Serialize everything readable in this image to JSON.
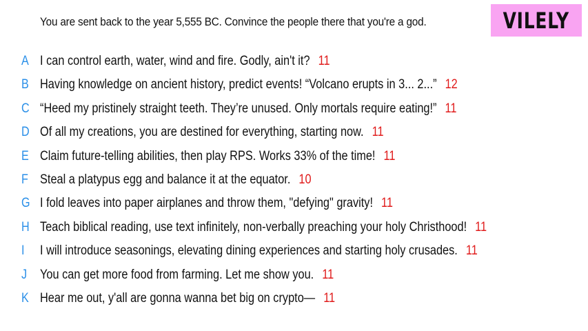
{
  "prompt": "You are sent back to the year 5,555 BC. Convince the people there that you're a god.",
  "logo": "VILELY",
  "colors": {
    "letter": "#2a8fe8",
    "score": "#e01b1b",
    "logo_bg": "#f9a4f2"
  },
  "answers": [
    {
      "letter": "A",
      "text": "I can control earth, water, wind and fire. Godly, ain't it?",
      "score": "11"
    },
    {
      "letter": "B",
      "text": "Having knowledge on ancient history, predict events! “Volcano erupts in 3... 2...”",
      "score": "12"
    },
    {
      "letter": "C",
      "text": "“Heed my pristinely straight teeth. They’re unused. Only mortals require eating!”",
      "score": "11"
    },
    {
      "letter": "D",
      "text": "Of all my creations, you are destined for everything, starting now.",
      "score": "11"
    },
    {
      "letter": "E",
      "text": "Claim future-telling abilities, then play RPS. Works 33% of the time!",
      "score": "11"
    },
    {
      "letter": "F",
      "text": "Steal a platypus egg and balance it at the equator.",
      "score": "10"
    },
    {
      "letter": "G",
      "text": "I fold leaves into paper airplanes and throw them, \"defying\" gravity!",
      "score": "11"
    },
    {
      "letter": "H",
      "text": "Teach biblical reading, use text infinitely, non-verbally preaching your holy Christhood!",
      "score": "11"
    },
    {
      "letter": "I",
      "text": "I will introduce seasonings, elevating dining experiences and starting holy crusades.",
      "score": "11"
    },
    {
      "letter": "J",
      "text": "You can get more food from farming. Let me show you.",
      "score": "11"
    },
    {
      "letter": "K",
      "text": "Hear me out, y'all are gonna wanna bet big on crypto—",
      "score": "11"
    }
  ]
}
